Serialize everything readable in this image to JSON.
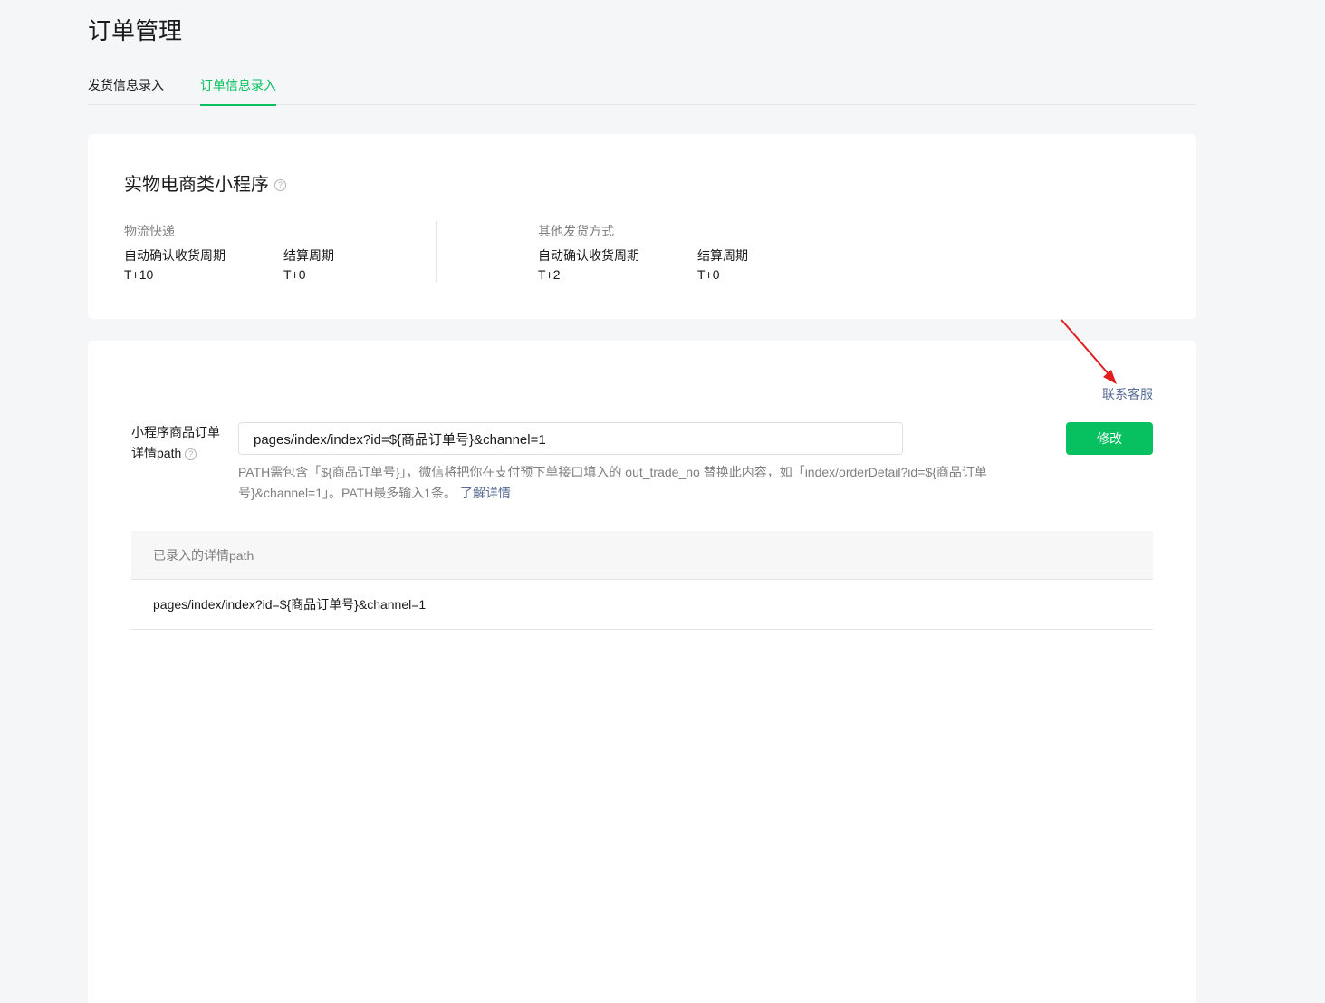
{
  "page": {
    "title": "订单管理"
  },
  "tabs": [
    {
      "label": "发货信息录入",
      "active": false
    },
    {
      "label": "订单信息录入",
      "active": true
    }
  ],
  "card1": {
    "title": "实物电商类小程序",
    "groups": [
      {
        "label": "物流快递",
        "fields": [
          {
            "label": "自动确认收货周期",
            "value": "T+10"
          },
          {
            "label": "结算周期",
            "value": "T+0"
          }
        ]
      },
      {
        "label": "其他发货方式",
        "fields": [
          {
            "label": "自动确认收货周期",
            "value": "T+2"
          },
          {
            "label": "结算周期",
            "value": "T+0"
          }
        ]
      }
    ]
  },
  "card2": {
    "contact_link": "联系客服",
    "form": {
      "label_line1": "小程序商品订单",
      "label_line2": "详情path",
      "input_value": "pages/index/index?id=${商品订单号}&channel=1",
      "button_label": "修改",
      "hint_text": "PATH需包含「${商品订单号}」，微信将把你在支付预下单接口填入的 out_trade_no 替换此内容，如「index/orderDetail?id=${商品订单号}&channel=1」。PATH最多输入1条。",
      "hint_link": "了解详情"
    },
    "table": {
      "header": "已录入的详情path",
      "rows": [
        "pages/index/index?id=${商品订单号}&channel=1"
      ]
    }
  },
  "colors": {
    "accent": "#07c160",
    "link": "#576b95",
    "annotation": "#e02020"
  },
  "icons": {
    "help": "question-circle-icon"
  }
}
